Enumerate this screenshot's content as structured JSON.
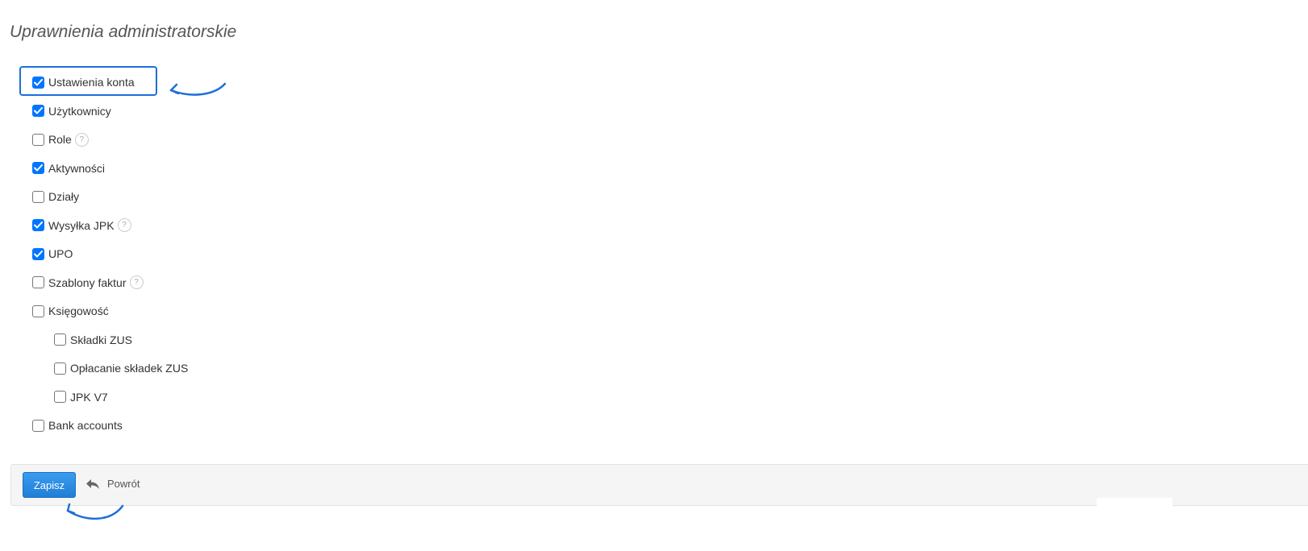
{
  "page": {
    "title": "Uprawnienia administratorskie"
  },
  "permissions": [
    {
      "label": "Ustawienia konta",
      "checked": true,
      "help": false,
      "indent": 0
    },
    {
      "label": "Użytkownicy",
      "checked": true,
      "help": false,
      "indent": 0
    },
    {
      "label": "Role",
      "checked": false,
      "help": true,
      "indent": 0
    },
    {
      "label": "Aktywności",
      "checked": true,
      "help": false,
      "indent": 0
    },
    {
      "label": "Działy",
      "checked": false,
      "help": false,
      "indent": 0
    },
    {
      "label": "Wysyłka JPK",
      "checked": true,
      "help": true,
      "indent": 0
    },
    {
      "label": "UPO",
      "checked": true,
      "help": false,
      "indent": 0
    },
    {
      "label": "Szablony faktur",
      "checked": false,
      "help": true,
      "indent": 0
    },
    {
      "label": "Księgowość",
      "checked": false,
      "help": false,
      "indent": 0
    },
    {
      "label": "Składki ZUS",
      "checked": false,
      "help": false,
      "indent": 1
    },
    {
      "label": "Opłacanie składek ZUS",
      "checked": false,
      "help": false,
      "indent": 1
    },
    {
      "label": "JPK V7",
      "checked": false,
      "help": false,
      "indent": 1
    },
    {
      "label": "Bank accounts",
      "checked": false,
      "help": false,
      "indent": 0
    }
  ],
  "help_icon_glyph": "?",
  "footer": {
    "save_label": "Zapisz",
    "back_label": "Powrót",
    "back_icon": "reply-icon"
  },
  "colors": {
    "accent": "#0075ff",
    "annotation": "#1e6fd9",
    "save_button": "#2d8ee5"
  }
}
